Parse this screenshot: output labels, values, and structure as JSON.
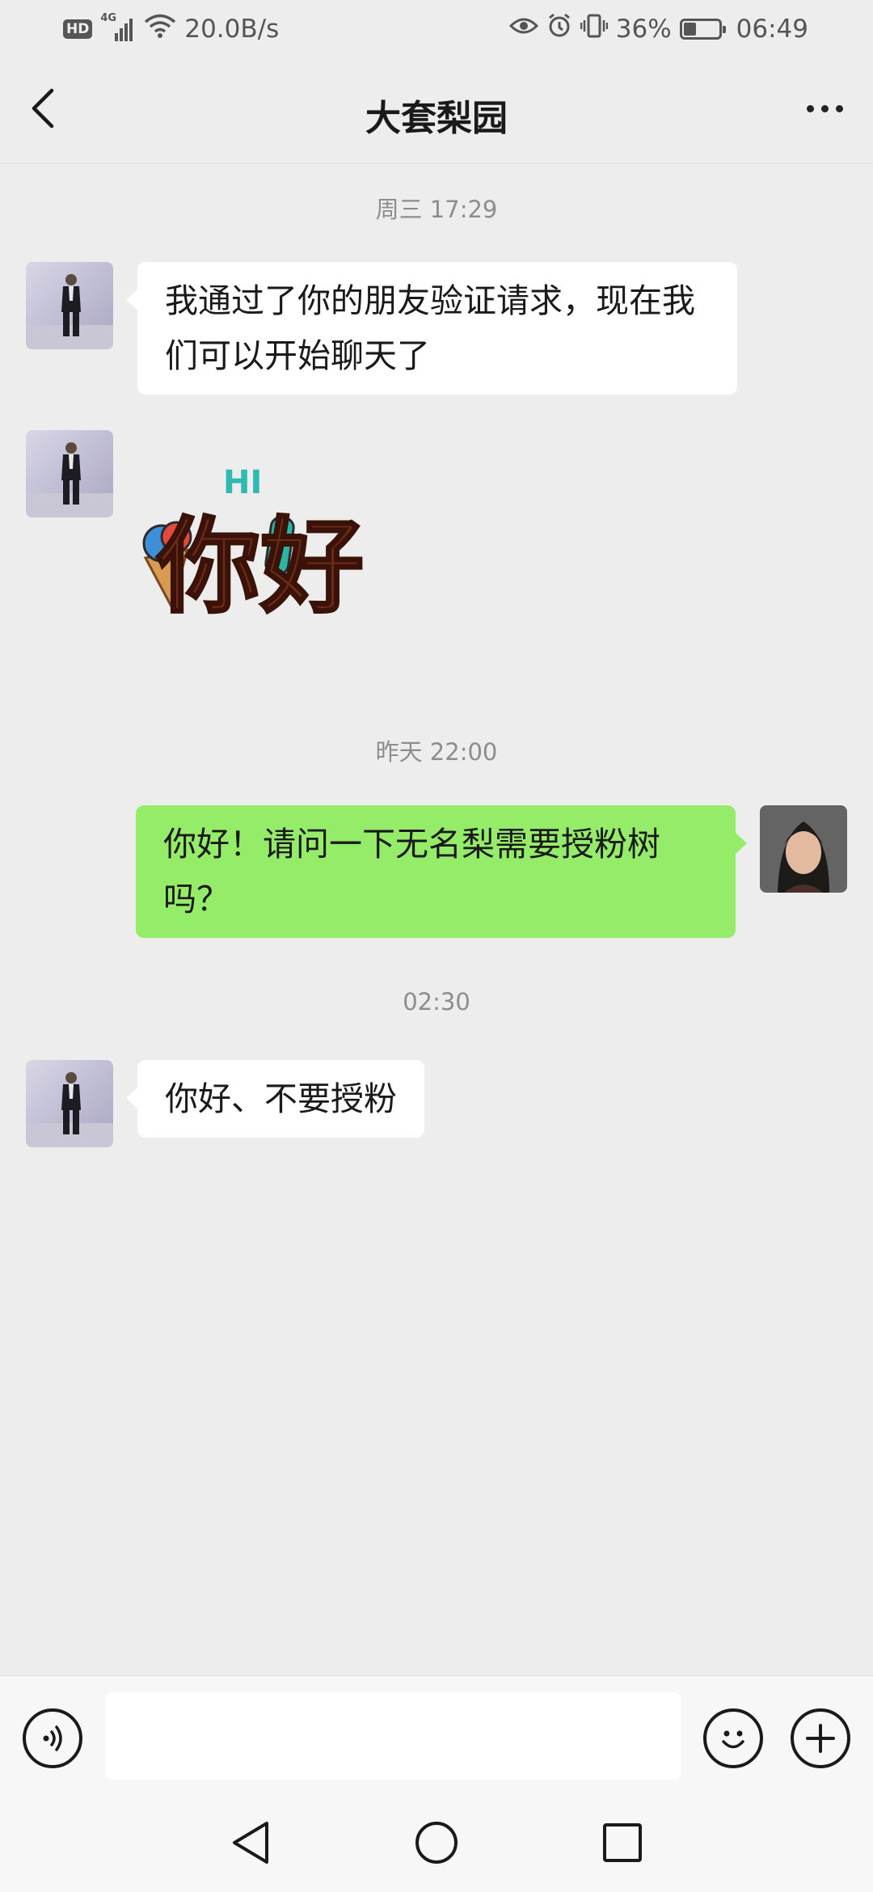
{
  "status_bar": {
    "hd": "HD",
    "network": "4G",
    "speed": "20.0B/s",
    "battery_percent": "36%",
    "battery_level": 0.36,
    "time": "06:49"
  },
  "header": {
    "title": "大套梨园",
    "back_icon": "chevron-left-icon",
    "more_icon": "more-horizontal-icon"
  },
  "messages": {
    "time_1": "周三 17:29",
    "msg_1": "我通过了你的朋友验证请求，现在我们可以开始聊天了",
    "sticker_hi": "HI",
    "sticker_text": "你好",
    "time_2": "昨天 22:00",
    "msg_2": "你好！请问一下无名梨需要授粉树吗？",
    "time_3": "02:30",
    "msg_3": "你好、不要授粉"
  },
  "colors": {
    "background": "#ededed",
    "incoming_bubble": "#ffffff",
    "outgoing_bubble": "#95ec69"
  },
  "input_bar": {
    "value": "",
    "voice_icon": "voice-icon",
    "emoji_icon": "emoji-icon",
    "plus_icon": "plus-icon"
  },
  "nav": {
    "back_icon": "nav-back-icon",
    "home_icon": "nav-home-icon",
    "recents_icon": "nav-recents-icon"
  }
}
